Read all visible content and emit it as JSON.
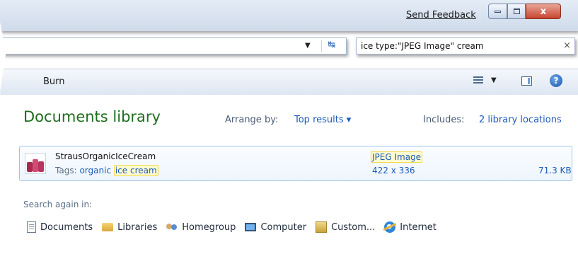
{
  "titlebar": {
    "send_feedback": "Send Feedback",
    "minimize_glyph": "",
    "maximize_glyph": "",
    "close_glyph": "x"
  },
  "address": {
    "refresh_glyph": "↹"
  },
  "search": {
    "query": "ice type:\"JPEG Image\" cream",
    "clear_glyph": "×"
  },
  "toolbar": {
    "burn_label": "Burn",
    "help_glyph": "?"
  },
  "library": {
    "title": "Documents library",
    "arrange_label": "Arrange by:",
    "arrange_value": "Top results ▾",
    "includes_label": "Includes:",
    "includes_value": "2 library locations"
  },
  "result": {
    "file_name": "StrausOrganicIceCream",
    "tags_label": "Tags:",
    "tag_1": "organic",
    "tag_2": "ice cream",
    "file_type": "JPEG Image",
    "dimensions": "422 x 336",
    "size": "71.3 KB"
  },
  "search_again": {
    "label": "Search again in:",
    "locations": [
      {
        "label": "Documents",
        "icon": "document-icon"
      },
      {
        "label": "Libraries",
        "icon": "libraries-icon"
      },
      {
        "label": "Homegroup",
        "icon": "homegroup-icon"
      },
      {
        "label": "Computer",
        "icon": "computer-icon"
      },
      {
        "label": "Custom...",
        "icon": "custom-folder-icon"
      },
      {
        "label": "Internet",
        "icon": "internet-explorer-icon"
      }
    ]
  },
  "colors": {
    "title_green": "#1e6e1e",
    "link_blue": "#1c5bb8",
    "highlight_fill": "#fffbd0",
    "highlight_border": "#f3d84a"
  }
}
